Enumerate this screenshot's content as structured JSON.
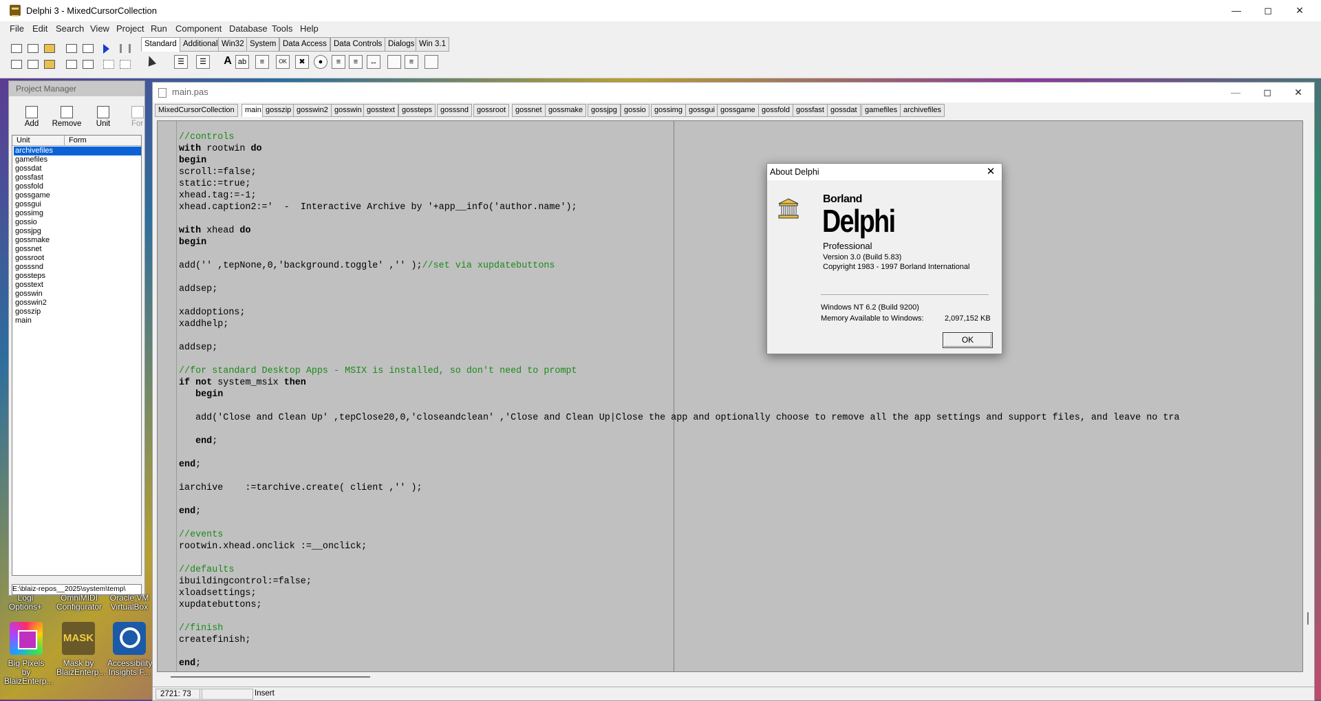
{
  "app": {
    "title": "Delphi 3 - MixedCursorCollection",
    "menu": [
      "File",
      "Edit",
      "Search",
      "View",
      "Project",
      "Run",
      "Component",
      "Database",
      "Tools",
      "Help"
    ]
  },
  "palette": {
    "tabs": [
      "Standard",
      "Additional",
      "Win32",
      "System",
      "Data Access",
      "Data Controls",
      "Dialogs",
      "Win 3.1"
    ],
    "active_tab": "Standard"
  },
  "project_manager": {
    "title": "Project Manager",
    "buttons": [
      "Add",
      "Remove",
      "Unit",
      "Form"
    ],
    "columns": [
      "Unit",
      "Form"
    ],
    "units": [
      "archivefiles",
      "gamefiles",
      "gossdat",
      "gossfast",
      "gossfold",
      "gossgame",
      "gossgui",
      "gossimg",
      "gossio",
      "gossjpg",
      "gossmake",
      "gossnet",
      "gossroot",
      "gosssnd",
      "gossteps",
      "gosstext",
      "gosswin",
      "gosswin2",
      "gosszip",
      "main"
    ],
    "selected": "archivefiles",
    "path": "E:\\blaiz-repos__2025\\system\\temp\\"
  },
  "desktop": {
    "icons": [
      {
        "label": "Big Pixels by BlaizEnterp...",
        "icon": "big-pixels-icon"
      },
      {
        "label": "Mask by BlaizEnterp...",
        "icon": "mask-icon"
      },
      {
        "label": "Accessibility Insights F...",
        "icon": "accessibility-insights-icon"
      }
    ],
    "partial_labels": [
      "Logi Options+",
      "OmniMIDI Configurator",
      "Oracle VM VirtualBox"
    ]
  },
  "editor": {
    "title": "main.pas",
    "tabs": [
      "MixedCursorCollection",
      "main",
      "gosszip",
      "gosswin2",
      "gosswin",
      "gosstext",
      "gossteps",
      "gosssnd",
      "gossroot",
      "gossnet",
      "gossmake",
      "gossjpg",
      "gossio",
      "gossimg",
      "gossgui",
      "gossgame",
      "gossfold",
      "gossfast",
      "gossdat",
      "gamefiles",
      "archivefiles"
    ],
    "active_tab": "main",
    "code": [
      "//controls",
      "with rootwin do",
      "begin",
      "scroll:=false;",
      "static:=true;",
      "xhead.tag:=-1;",
      "xhead.caption2:='  -  Interactive Archive by '+app__info('author.name');",
      "",
      "with xhead do",
      "begin",
      "",
      "add('' ,tepNone,0,'background.toggle' ,'' );//set via xupdatebuttons",
      "",
      "addsep;",
      "",
      "xaddoptions;",
      "xaddhelp;",
      "",
      "addsep;",
      "",
      "//for standard Desktop Apps - MSIX is installed, so don't need to prompt",
      "if not system_msix then",
      "   begin",
      "",
      "   add('Close and Clean Up' ,tepClose20,0,'closeandclean' ,'Close and Clean Up|Close the app and optionally choose to remove all the app settings and support files, and leave no tra",
      "",
      "   end;",
      "",
      "end;",
      "",
      "iarchive    :=tarchive.create( client ,'' );",
      "",
      "end;",
      "",
      "//events",
      "rootwin.xhead.onclick :=__onclick;",
      "",
      "//defaults",
      "ibuildingcontrol:=false;",
      "xloadsettings;",
      "xupdatebuttons;",
      "",
      "//finish",
      "createfinish;",
      "",
      "end;"
    ],
    "status": {
      "position": "2721:  73",
      "modified": "",
      "mode": "Insert"
    }
  },
  "about": {
    "title": "About Delphi",
    "brand_small": "Borland",
    "brand_big": "Delphi",
    "edition": "Professional",
    "version": "Version 3.0  (Build 5.83)",
    "copyright": "Copyright 1983 - 1997  Borland International",
    "os": "Windows NT 6.2 (Build 9200)",
    "memory_label": "Memory Available to Windows:",
    "memory_value": "2,097,152 KB",
    "ok_label": "OK"
  }
}
